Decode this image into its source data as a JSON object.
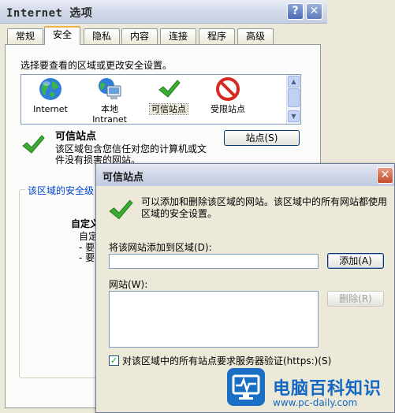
{
  "main_window": {
    "title": "Internet 选项",
    "help_glyph": "?",
    "close_glyph": "✕",
    "tabs": [
      "常规",
      "安全",
      "隐私",
      "内容",
      "连接",
      "程序",
      "高级"
    ],
    "active_tab": "安全",
    "zone_prompt": "选择要查看的区域或更改安全设置。",
    "zones": [
      {
        "label": "Internet",
        "label2": "",
        "icon": "globe-icon"
      },
      {
        "label": "本地",
        "label2": "Intranet",
        "icon": "computer-globe-icon"
      },
      {
        "label": "可信站点",
        "label2": "",
        "icon": "checkmark-icon"
      },
      {
        "label": "受限站点",
        "label2": "",
        "icon": "prohibited-icon"
      }
    ],
    "selected_zone": "可信站点",
    "trusted_heading": "可信站点",
    "trusted_desc": "该区域包含您信任对您的计算机或文件没有损害的网站。",
    "sites_button": "站点(S)",
    "security_level_legend": "该区域的安全级",
    "custom_heading": "自定义",
    "custom_desc": "自定",
    "dash_lines": [
      "- 要",
      "- 要"
    ]
  },
  "sites_dialog": {
    "title": "可信站点",
    "close_glyph": "✕",
    "info": "可以添加和删除该区域的网站。该区域中的所有网站都使用区域的安全设置。",
    "add_label": "将该网站添加到区域(D):",
    "add_value": "",
    "add_button": "添加(A)",
    "websites_label": "网站(W):",
    "remove_button": "删除(R)",
    "https_checked": true,
    "https_label": "对该区域中的所有站点要求服务器验证(https:)(S)"
  },
  "watermark": {
    "brand": "电脑百科知识",
    "url": "www.pc-daily.com",
    "color": "#1468c3"
  }
}
